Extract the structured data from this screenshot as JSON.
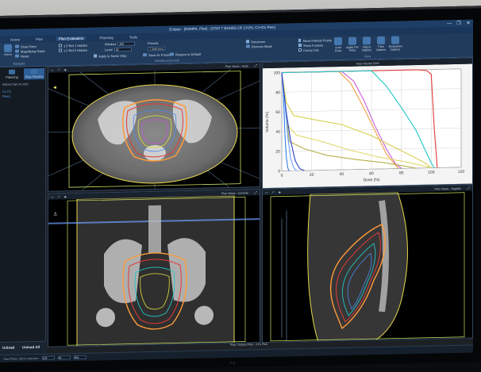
{
  "window": {
    "title": "Eclipse - [RAMPA, Plan] - [STAT 7 BANDS OF LYON, C4+D1 Plan]",
    "controls": [
      "—",
      "❐",
      "✕"
    ]
  },
  "menu": {
    "tabs": [
      "Home",
      "Plan",
      "Plan Evaluation",
      "Planning",
      "Tools"
    ],
    "active": 2
  },
  "ribbon": {
    "draw_point": "Draw Point",
    "magnifying_glass": "Magnifying Glass",
    "reset": "Reset",
    "navigate_label": "Navigate",
    "ref_line_1": "1.0 Ref 1 Hidden",
    "ref_line_2": "1.0 Ref 2 Hidden",
    "window_level_label": "Window and Level",
    "window_label": "Window",
    "window_value": "400",
    "level_label": "Level",
    "level_value": "40",
    "presets_label": "Presets",
    "presets_value": "T Soft tissue",
    "w_label": "W/L",
    "show_in_same_step": "Apply to Same Step",
    "save_as_preset": "Save As Preset",
    "restore_default": "Restore to Default",
    "structures_visible": "Structures",
    "remove_mask": "Remove Mask",
    "show_interest_points": "Show Interest Points",
    "show_fusions": "Show Fusions",
    "cursor_info": "Cursor Info",
    "display_options": "Display Options",
    "big_buttons": [
      "Auto Draw",
      "Apply Per Point",
      "Adjust Options",
      "Plan Options",
      "Evaluation Options"
    ],
    "view_label": "View",
    "active_tool": "Active"
  },
  "left_panel": {
    "tabs": [
      "Planning",
      "Plan Review"
    ],
    "active_tab": 1,
    "patient_line": "REDACTED-PLANS",
    "links": [
      "C1 P1",
      "Plan1"
    ],
    "bottom_buttons": [
      "Unload",
      "Unload All"
    ]
  },
  "viewports": {
    "axial": {
      "title": "Plan Views - Axial"
    },
    "dvh": {
      "title": "Total Volume DVH"
    },
    "coronal": {
      "title": "Plan Views - Coronal"
    },
    "sagittal": {
      "title": "Plan Views - Sagittal"
    },
    "tools": [
      "▭",
      "↶",
      "◆",
      "⤢"
    ]
  },
  "status": {
    "left": "Total Plans: 256 in selection",
    "left_fields": [
      "128",
      "40",
      "450"
    ],
    "center": "Plan: Sarasa Plan · 3 Fx Plan",
    "time": "4:52",
    "date": "06/03/24"
  },
  "monitor_brand": "hp",
  "chart_data": {
    "type": "line",
    "title": "Total Volume DVH",
    "xlabel": "Dose (%)",
    "ylabel": "Volume (%)",
    "xlim": [
      0,
      120
    ],
    "ylim": [
      0,
      100
    ],
    "xticks": [
      0,
      20,
      40,
      60,
      80,
      100,
      120
    ],
    "yticks": [
      0,
      20,
      40,
      60,
      80,
      100
    ],
    "grid": true,
    "series": [
      {
        "color": "#e23b3b",
        "x": [
          0,
          60,
          90,
          97,
          100,
          102,
          104
        ],
        "y": [
          100,
          100,
          100,
          99,
          95,
          40,
          0
        ]
      },
      {
        "color": "#c85ad8",
        "x": [
          0,
          40,
          48,
          55,
          62,
          70,
          76,
          80
        ],
        "y": [
          100,
          100,
          90,
          70,
          45,
          20,
          5,
          0
        ]
      },
      {
        "color": "#f0a040",
        "x": [
          0,
          38,
          46,
          54,
          62,
          70,
          78
        ],
        "y": [
          100,
          100,
          88,
          65,
          40,
          15,
          0
        ]
      },
      {
        "color": "#22c6c6",
        "x": [
          0,
          60,
          70,
          80,
          90,
          96,
          100,
          102
        ],
        "y": [
          100,
          100,
          84,
          62,
          38,
          18,
          5,
          0
        ]
      },
      {
        "color": "#d6d04a",
        "x": [
          0,
          3,
          8,
          20,
          40,
          60,
          80,
          95,
          100
        ],
        "y": [
          100,
          70,
          56,
          52,
          46,
          34,
          18,
          6,
          0
        ]
      },
      {
        "color": "#e0d86a",
        "x": [
          0,
          4,
          10,
          25,
          45,
          65,
          85,
          100
        ],
        "y": [
          100,
          46,
          36,
          30,
          20,
          12,
          6,
          0
        ]
      },
      {
        "color": "#b8b04a",
        "x": [
          0,
          5,
          15,
          30,
          50,
          70,
          90
        ],
        "y": [
          100,
          30,
          22,
          15,
          10,
          6,
          0
        ]
      },
      {
        "color": "#2f7fe6",
        "x": [
          0,
          1,
          2,
          3,
          4,
          5
        ],
        "y": [
          100,
          80,
          40,
          15,
          3,
          0
        ]
      },
      {
        "color": "#6f9fff",
        "x": [
          0,
          2,
          4,
          6,
          8,
          10
        ],
        "y": [
          100,
          70,
          35,
          12,
          3,
          0
        ]
      },
      {
        "color": "#2b45c8",
        "x": [
          0,
          3,
          6,
          9,
          12,
          15
        ],
        "y": [
          100,
          60,
          30,
          10,
          2,
          0
        ]
      }
    ]
  }
}
